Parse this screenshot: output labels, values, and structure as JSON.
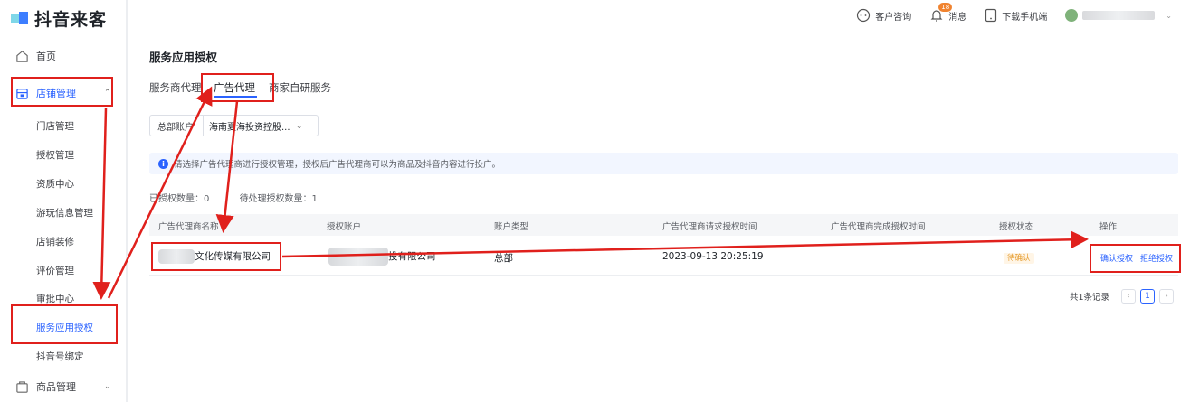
{
  "app": {
    "logo_text": "抖音来客"
  },
  "header": {
    "customer_service": "客户咨询",
    "messages": "消息",
    "message_badge": "18",
    "download": "下载手机端"
  },
  "sidebar": {
    "home": "首页",
    "store_mgmt": "店铺管理",
    "store_items": [
      "门店管理",
      "授权管理",
      "资质中心",
      "游玩信息管理",
      "店铺装修",
      "评价管理",
      "审批中心",
      "服务应用授权",
      "抖音号绑定"
    ],
    "goods_mgmt": "商品管理"
  },
  "main": {
    "title": "服务应用授权",
    "tabs": [
      "服务商代理",
      "广告代理",
      "商家自研服务"
    ],
    "active_tab": "广告代理",
    "account_select": {
      "label": "总部账户",
      "value": "海南夏海投资控股..."
    },
    "info_text": "请选择广告代理商进行授权管理，授权后广告代理商可以为商品及抖音内容进行投广。",
    "authorized_count": "已授权数量：0",
    "pending_count": "待处理授权数量：1",
    "table": {
      "columns": [
        "广告代理商名称",
        "授权账户",
        "账户类型",
        "广告代理商请求授权时间",
        "广告代理商完成授权时间",
        "授权状态",
        "操作"
      ],
      "rows": [
        {
          "agency_name": "文化传媒有限公司",
          "auth_account": "投有限公司",
          "account_type": "总部",
          "request_time": "2023-09-13 20:25:19",
          "complete_time": "",
          "status": "待确认",
          "actions": [
            "确认授权",
            "拒绝授权"
          ]
        }
      ]
    },
    "pagination": {
      "total": "共1条记录",
      "current_page": "1"
    }
  },
  "colors": {
    "accent": "#2b63ff",
    "annotation": "#e0201c",
    "pending": "#e59a2a"
  }
}
